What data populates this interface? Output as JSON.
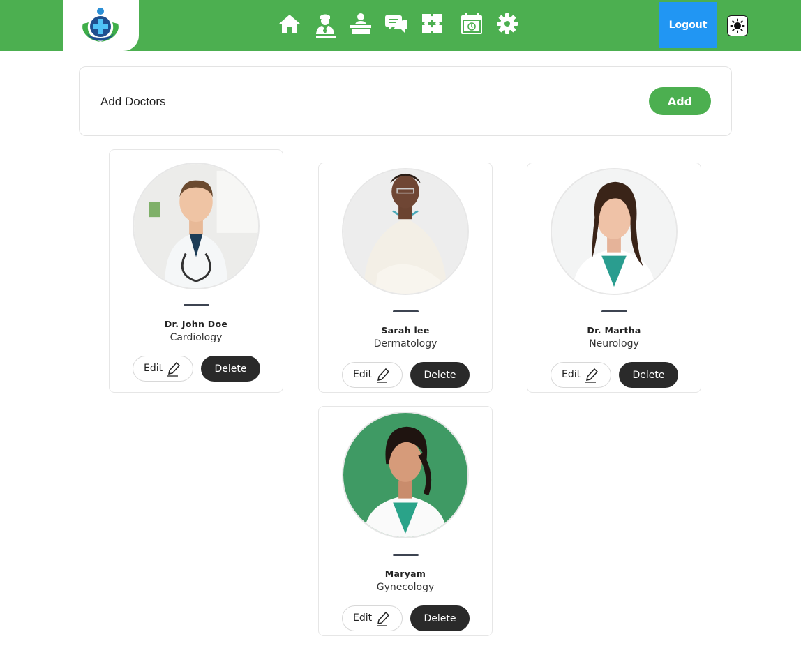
{
  "nav": {
    "logo_icon": "medical-cross-leaves-logo",
    "icons": [
      "home-icon",
      "doctor-icon",
      "reception-desk-icon",
      "chat-icon",
      "puzzle-icon",
      "calendar-icon",
      "gear-icon"
    ],
    "active_icon": "doctor-icon",
    "logout_label": "Logout",
    "theme_icon": "sun-icon",
    "colors": {
      "bar": "#4caf50",
      "logout": "#2196f3"
    }
  },
  "add_panel": {
    "title": "Add Doctors",
    "button_label": "Add"
  },
  "doctors": [
    {
      "name": "Dr. John Doe",
      "specialty": "Cardiology",
      "edit_label": "Edit",
      "delete_label": "Delete"
    },
    {
      "name": "Sarah lee",
      "specialty": "Dermatology",
      "edit_label": "Edit",
      "delete_label": "Delete"
    },
    {
      "name": "Dr. Martha",
      "specialty": "Neurology",
      "edit_label": "Edit",
      "delete_label": "Delete"
    },
    {
      "name": "Maryam",
      "specialty": "Gynecology",
      "edit_label": "Edit",
      "delete_label": "Delete"
    }
  ]
}
